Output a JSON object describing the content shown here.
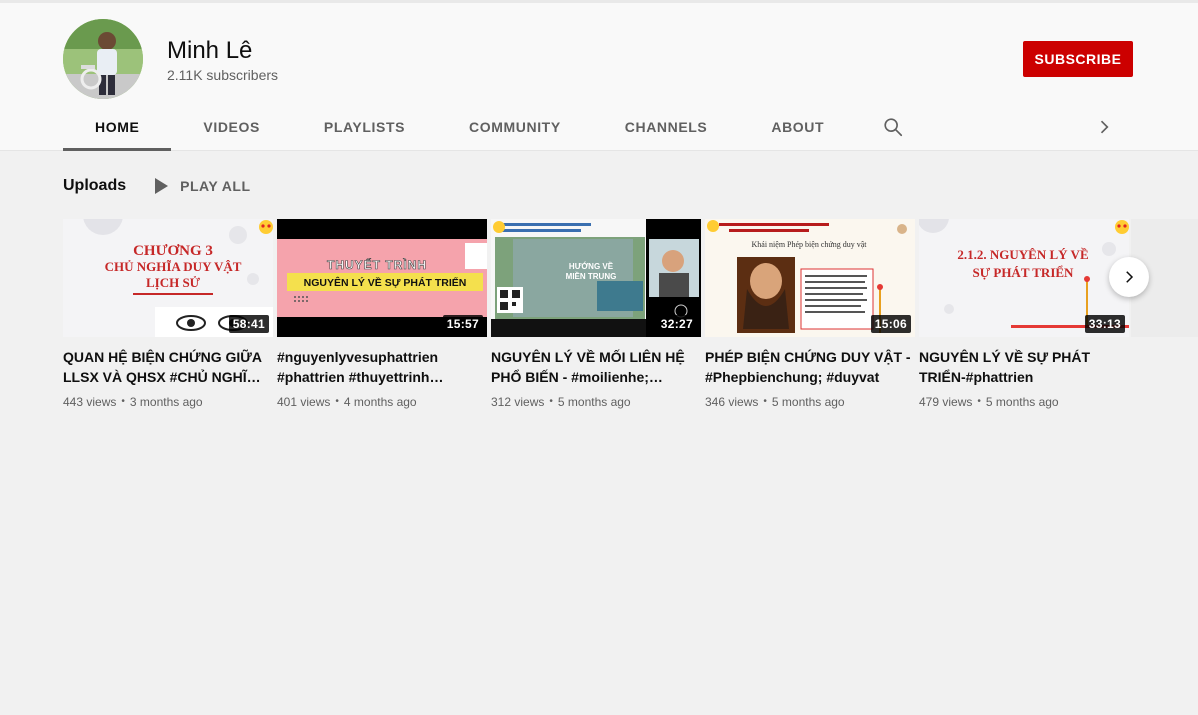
{
  "channel": {
    "name": "Minh Lê",
    "subscribers": "2.11K subscribers",
    "subscribe_label": "SUBSCRIBE"
  },
  "tabs": [
    {
      "label": "HOME",
      "active": true
    },
    {
      "label": "VIDEOS"
    },
    {
      "label": "PLAYLISTS"
    },
    {
      "label": "COMMUNITY"
    },
    {
      "label": "CHANNELS"
    },
    {
      "label": "ABOUT"
    }
  ],
  "icons": {
    "search": "search-icon",
    "next": "chevron-right-icon",
    "play": "play-icon"
  },
  "section": {
    "title": "Uploads",
    "play_all": "PLAY ALL"
  },
  "videos": [
    {
      "title": "QUAN HỆ BIỆN CHỨNG GIỮA LLSX VÀ QHSX #CHỦ NGHĨA DUY VẬT LỊCH SỬ",
      "duration": "58:41",
      "views": "443 views",
      "age": "3 months ago",
      "thumb_text": [
        "CHƯƠNG 3",
        "CHỦ NGHĨA DUY VẬT",
        "LỊCH SỬ"
      ]
    },
    {
      "title": "#nguyenlyvesuphattrien #phattrien #thuyettrinh #triethoc",
      "duration": "15:57",
      "views": "401 views",
      "age": "4 months ago",
      "thumb_text": [
        "THUYẾT TRÌNH",
        "NGUYÊN LÝ VỀ SỰ PHÁT TRIỂN"
      ]
    },
    {
      "title": "NGUYÊN LÝ VỀ MỐI LIÊN HỆ PHỔ BIẾN - #moilienhe; #phobien",
      "duration": "32:27",
      "views": "312 views",
      "age": "5 months ago",
      "thumb_text": [
        "HƯỚNG VỀ",
        "MIỀN TRUNG"
      ]
    },
    {
      "title": "PHÉP BIỆN CHỨNG DUY VẬT - #Phepbienchung; #duyvat",
      "duration": "15:06",
      "views": "346 views",
      "age": "5 months ago",
      "thumb_text": [
        "Khái niệm Phép biện chứng duy vật"
      ]
    },
    {
      "title": "NGUYÊN LÝ VỀ SỰ PHÁT TRIỂN-#phattrien",
      "duration": "33:13",
      "views": "479 views",
      "age": "5 months ago",
      "thumb_text": [
        "2.1.2. NGUYÊN LÝ VỀ",
        "SỰ PHÁT TRIỂN"
      ]
    }
  ],
  "colors": {
    "subscribe": "#cc0000",
    "background": "#f1f1f1",
    "header": "#f9f9f9",
    "secondary_text": "#606060"
  }
}
